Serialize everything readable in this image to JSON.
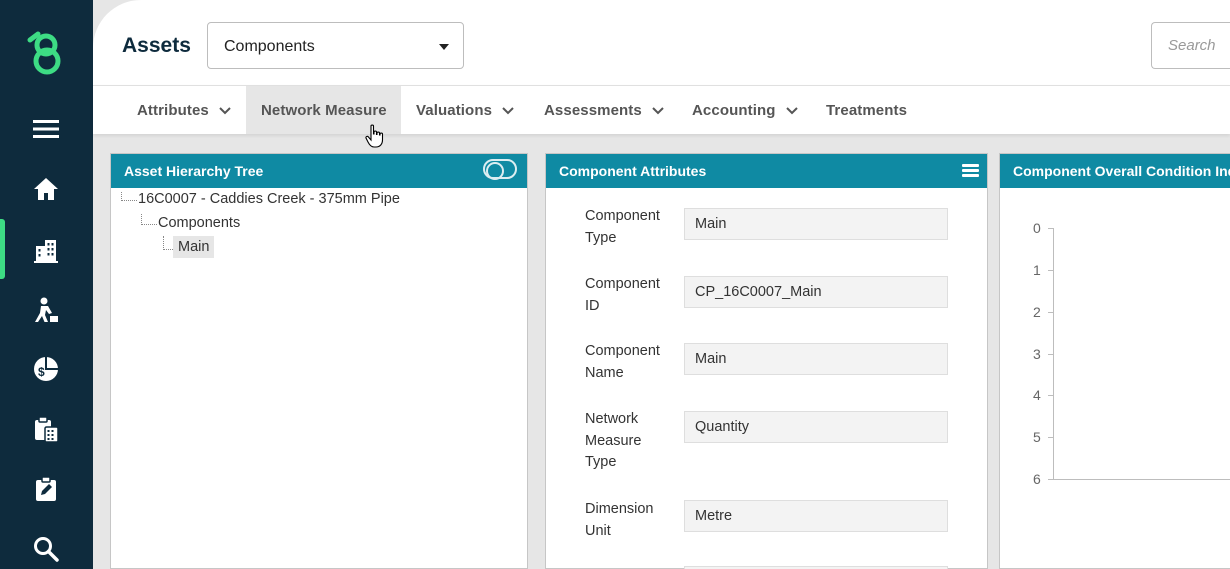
{
  "header": {
    "title": "Assets",
    "module_select": {
      "value": "Components"
    },
    "search": {
      "placeholder": "Search"
    }
  },
  "sidebar": {
    "items": [
      {
        "icon": "menu-icon"
      },
      {
        "icon": "home-icon"
      },
      {
        "icon": "buildings-icon",
        "active": true
      },
      {
        "icon": "worker-icon"
      },
      {
        "icon": "dollar-chart-icon"
      },
      {
        "icon": "clipboard-calculator-icon"
      },
      {
        "icon": "clipboard-edit-icon"
      },
      {
        "icon": "search-icon"
      }
    ],
    "accent_color": "#3ddc84"
  },
  "tabs": [
    {
      "label": "Attributes",
      "has_dropdown": true
    },
    {
      "label": "Network Measure",
      "has_dropdown": false,
      "active": true
    },
    {
      "label": "Valuations",
      "has_dropdown": true
    },
    {
      "label": "Assessments",
      "has_dropdown": true
    },
    {
      "label": "Accounting",
      "has_dropdown": true
    },
    {
      "label": "Treatments",
      "has_dropdown": false
    }
  ],
  "hierarchy_panel": {
    "title": "Asset Hierarchy Tree",
    "tree": {
      "root": "16C0007 - Caddies Creek - 375mm Pipe",
      "child": "Components",
      "leaf": "Main"
    }
  },
  "attributes_panel": {
    "title": "Component Attributes",
    "fields": [
      {
        "label": "Component Type",
        "value": "Main"
      },
      {
        "label": "Component ID",
        "value": "CP_16C0007_Main"
      },
      {
        "label": "Component Name",
        "value": "Main"
      },
      {
        "label": "Network Measure Type",
        "value": "Quantity"
      },
      {
        "label": "Dimension Unit",
        "value": "Metre"
      }
    ]
  },
  "condition_panel": {
    "title": "Component Overall Condition Index"
  },
  "chart_data": {
    "type": "line",
    "title": "",
    "xlabel": "",
    "ylabel": "",
    "y_ticks": [
      "0",
      "1",
      "2",
      "3",
      "4",
      "5",
      "6"
    ],
    "ylim": [
      0,
      6
    ],
    "y_inverted": true,
    "series": []
  },
  "colors": {
    "sidebar_bg": "#0e2b3d",
    "panel_header": "#0f8aa3",
    "accent": "#3ddc84"
  }
}
